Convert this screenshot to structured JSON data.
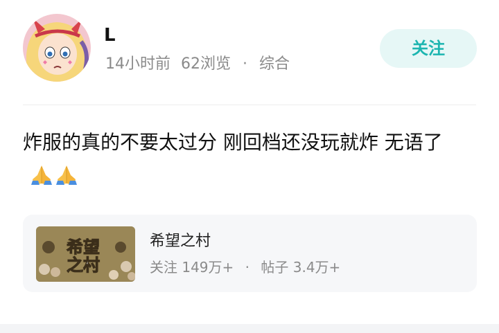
{
  "post": {
    "author": {
      "name": "L",
      "time_ago": "14小时前",
      "views": "62浏览",
      "separator": "·",
      "category": "综合"
    },
    "follow_label": "关注",
    "content": "炸服的真的不要太过分 刚回档还没玩就炸 无语了",
    "emoji": [
      "folded-hands-icon",
      "folded-hands-icon"
    ]
  },
  "forum": {
    "name": "希望之村",
    "thumbnail_text": "希望之村",
    "followers": "关注 149万+",
    "separator": "·",
    "posts": "帖子 3.4万+"
  },
  "colors": {
    "accent": "#1cb5b0",
    "follow_bg": "#e6f7f6",
    "meta_text": "#8a8a8a",
    "card_bg": "#f6f7f9"
  }
}
